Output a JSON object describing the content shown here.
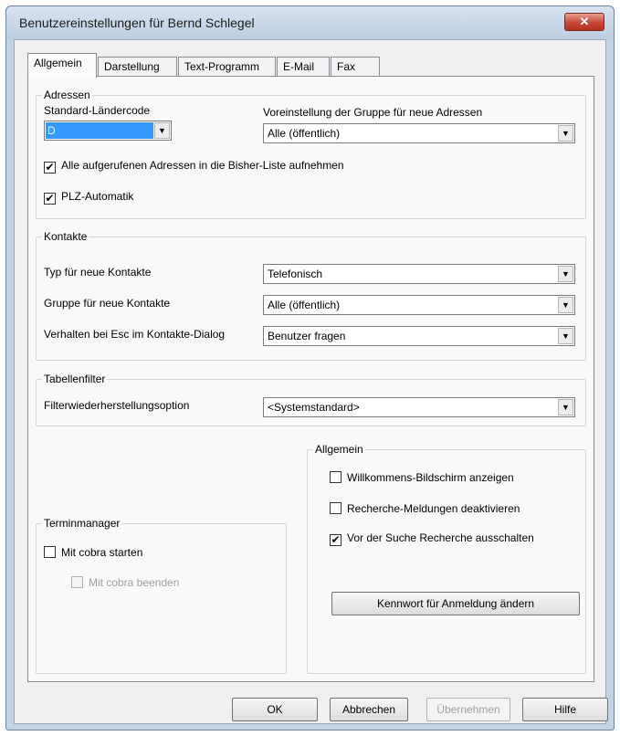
{
  "window": {
    "title": "Benutzereinstellungen für Bernd Schlegel",
    "close_label": "✕"
  },
  "tabs": [
    {
      "label": "Allgemein"
    },
    {
      "label": "Darstellung"
    },
    {
      "label": "Text-Programm"
    },
    {
      "label": "E-Mail"
    },
    {
      "label": "Fax"
    }
  ],
  "adressen": {
    "title": "Adressen",
    "laendercode_label": "Standard-Ländercode",
    "laendercode_value": "D",
    "gruppe_label": "Voreinstellung der Gruppe für neue Adressen",
    "gruppe_value": "Alle (öffentlich)",
    "bisher_liste": {
      "label": "Alle aufgerufenen Adressen in die Bisher-Liste aufnehmen",
      "checked": true
    },
    "plz": {
      "label": "PLZ-Automatik",
      "checked": true
    }
  },
  "kontakte": {
    "title": "Kontakte",
    "typ_label": "Typ für neue Kontakte",
    "typ_value": "Telefonisch",
    "gruppe_label": "Gruppe für neue Kontakte",
    "gruppe_value": "Alle (öffentlich)",
    "esc_label": "Verhalten bei Esc im Kontakte-Dialog",
    "esc_value": "Benutzer fragen"
  },
  "tabellenfilter": {
    "title": "Tabellenfilter",
    "option_label": "Filterwiederherstellungsoption",
    "option_value": "<Systemstandard>"
  },
  "terminmanager": {
    "title": "Terminmanager",
    "starten": {
      "label": "Mit cobra starten",
      "checked": false
    },
    "beenden": {
      "label": "Mit cobra beenden",
      "checked": false,
      "disabled": true
    }
  },
  "allgemein": {
    "title": "Allgemein",
    "willkommen": {
      "label": "Willkommens-Bildschirm anzeigen",
      "checked": false
    },
    "recherche": {
      "label": "Recherche-Meldungen deaktivieren",
      "checked": false
    },
    "suche": {
      "label": "Vor der Suche Recherche ausschalten",
      "checked": true
    },
    "kennwort_button": "Kennwort für Anmeldung ändern"
  },
  "buttons": {
    "ok": "OK",
    "abbrechen": "Abbrechen",
    "uebernehmen": "Übernehmen",
    "hilfe": "Hilfe"
  },
  "check_glyph": "✔"
}
